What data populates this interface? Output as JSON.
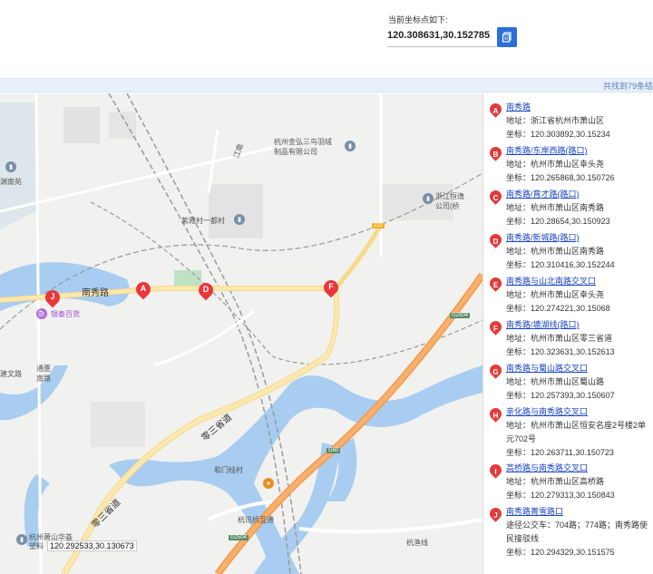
{
  "coord": {
    "label": "当前坐标点如下:",
    "value": "120.308631,30.152785"
  },
  "result_bar": {
    "count_text": "共找到79条结"
  },
  "map": {
    "labels": {
      "nanxiu_road": "南秀路",
      "yintai": "银泰百货",
      "zijin": "紫霞村一都村",
      "factory": "杭州金弘三鸟羽绒\n制品有限公司",
      "hengyi": "浙江恒逸\n公司(桥",
      "lingsan_1": "零三省道",
      "lingsan_2": "零三省道",
      "hemen": "和门桂村",
      "hangxun": "杭讯桥互通",
      "hangyu": "杭渔线",
      "jiangnan": "江南",
      "tongyi": "通惠\n南路",
      "hengbei": "建文路",
      "hz_xiaoshan": "杭州萧山华荟\n望料",
      "lan": "渊南苑"
    },
    "badges": {
      "g2504": "G2504",
      "g60": "G60",
      "g2504b": "G2504",
      "r222": "222"
    },
    "tooltip": "120.292533,30.130673",
    "markers": [
      {
        "letter": "A"
      },
      {
        "letter": "D"
      },
      {
        "letter": "F"
      },
      {
        "letter": "J"
      }
    ]
  },
  "results": [
    {
      "letter": "A",
      "title": "南秀路",
      "addr": "地址：浙江省杭州市萧山区",
      "coord": "坐标：120.303892,30.15234"
    },
    {
      "letter": "B",
      "title": "南秀路/东岸西路(路口)",
      "addr": "地址：杭州市萧山区幸头尧",
      "coord": "坐标：120.265868,30.150726"
    },
    {
      "letter": "C",
      "title": "南秀路/育才路(路口)",
      "addr": "地址：杭州市萧山区南秀路",
      "coord": "坐标：120.28654,30.150923"
    },
    {
      "letter": "D",
      "title": "南秀路/新城路(路口)",
      "addr": "地址：杭州市萧山区南秀路",
      "coord": "坐标：120.310416,30.152244"
    },
    {
      "letter": "E",
      "title": "南秀路与山北南路交叉口",
      "addr": "地址：杭州市萧山区幸头尧",
      "coord": "坐标：120.274221,30.15068"
    },
    {
      "letter": "F",
      "title": "南秀路/塘湖线(路口)",
      "addr": "地址：杭州市萧山区零三省道",
      "coord": "坐标：120.323631,30.152613"
    },
    {
      "letter": "G",
      "title": "南秀路与蜀山路交叉口",
      "addr": "地址：杭州市萧山区蜀山路",
      "coord": "坐标：120.257393,30.150607"
    },
    {
      "letter": "H",
      "title": "亲化路与南秀路交叉口",
      "addr": "地址：杭州市萧山区恒安名座2号楼2单元702号",
      "coord": "坐标：120.263711,30.150723"
    },
    {
      "letter": "I",
      "title": "高桥路与南秀路交叉口",
      "addr": "地址：杭州市萧山区高桥路",
      "coord": "坐标：120.279313,30.150843"
    },
    {
      "letter": "J",
      "title": "南秀路菁雪路口",
      "addr": "途径公交车：704路；774路；南秀路使民接驳线",
      "coord": "坐标：120.294329,30.151575"
    }
  ],
  "colors": {
    "accent": "#2b6fd8",
    "marker": "#e8363a",
    "link": "#1a44c2",
    "water": "#a8cdf0",
    "highway": "#f5a457"
  }
}
